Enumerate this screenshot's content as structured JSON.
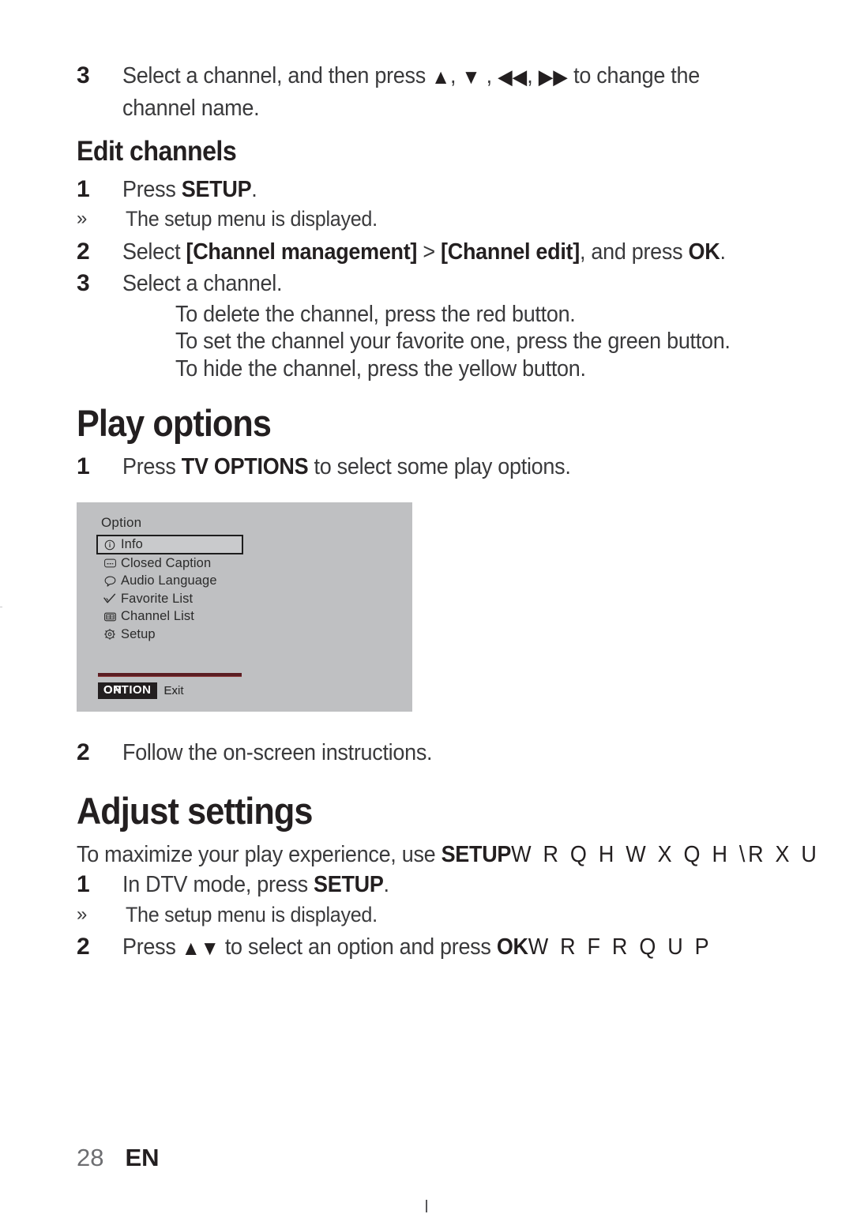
{
  "page": {
    "number": "28",
    "language": "EN"
  },
  "top_step": {
    "num": "3",
    "text_before": "Select a channel, and then press ",
    "arrow_up": "▲",
    "sep1": ", ",
    "arrow_down": "▼",
    "sep2": " , ",
    "arrow_rew": "◀◀",
    "sep3": ", ",
    "arrow_ff": "▶▶",
    "text_after": " to change the channel name."
  },
  "edit_channels": {
    "heading": "Edit channels",
    "step1": {
      "num": "1",
      "text_before": "Press ",
      "bold": "SETUP",
      "text_after": "."
    },
    "note1": {
      "guillemet": "»",
      "text": "The setup menu is displayed."
    },
    "step2": {
      "num": "2",
      "p1": "Select ",
      "b1": "[Channel management]",
      "p2": " > ",
      "b2": "[Channel edit]",
      "p3": ", and press ",
      "b3": "OK",
      "p4": "."
    },
    "step3": {
      "num": "3",
      "text": "Select a channel."
    },
    "bullets": [
      "To delete the channel, press the red button.",
      "To set the channel your favorite one, press the green button.",
      "To hide the channel, press the yellow button."
    ]
  },
  "play_options": {
    "heading": "Play options",
    "step1": {
      "num": "1",
      "text_before": "Press ",
      "bold": "TV OPTIONS",
      "text_after": " to select some play options."
    },
    "step2": {
      "num": "2",
      "text": "Follow the on-screen instructions."
    }
  },
  "osd": {
    "title": "Option",
    "items": [
      {
        "icon": "info-icon",
        "label": "Info",
        "selected": true
      },
      {
        "icon": "closed-caption-icon",
        "label": "Closed Caption",
        "selected": false
      },
      {
        "icon": "audio-language-icon",
        "label": "Audio Language",
        "selected": false
      },
      {
        "icon": "favorite-check-icon",
        "label": "Favorite List",
        "selected": false
      },
      {
        "icon": "channel-list-icon",
        "label": "Channel List",
        "selected": false
      },
      {
        "icon": "setup-gear-icon",
        "label": "Setup",
        "selected": false
      }
    ],
    "footer": {
      "key_label": "OPTION",
      "key_label_overprint": "ON",
      "action_label": "Exit",
      "action_label_overprint": "Ex"
    },
    "colors": {
      "background": "#bfc0c2",
      "text": "#2b2b2b",
      "rule": "#5a1d22",
      "key_background": "#231f20",
      "key_text": "#ffffff"
    }
  },
  "adjust_settings": {
    "heading": "Adjust settings",
    "intro": {
      "p1": "To maximize your play experience, use ",
      "b1": "SETUP",
      "garbled": "W R    Q H   W X Q H   \\R X U"
    },
    "step1": {
      "num": "1",
      "text_before": "In DTV mode, press ",
      "bold": "SETUP",
      "text_after": "."
    },
    "note1": {
      "guillemet": "»",
      "text": "The setup menu is displayed."
    },
    "step2": {
      "num": "2",
      "p1": "Press ",
      "arrows": "▲▼",
      "p2": " to select an option and press ",
      "b1": "OK",
      "garbled": "W R   F R Q   U P"
    }
  }
}
